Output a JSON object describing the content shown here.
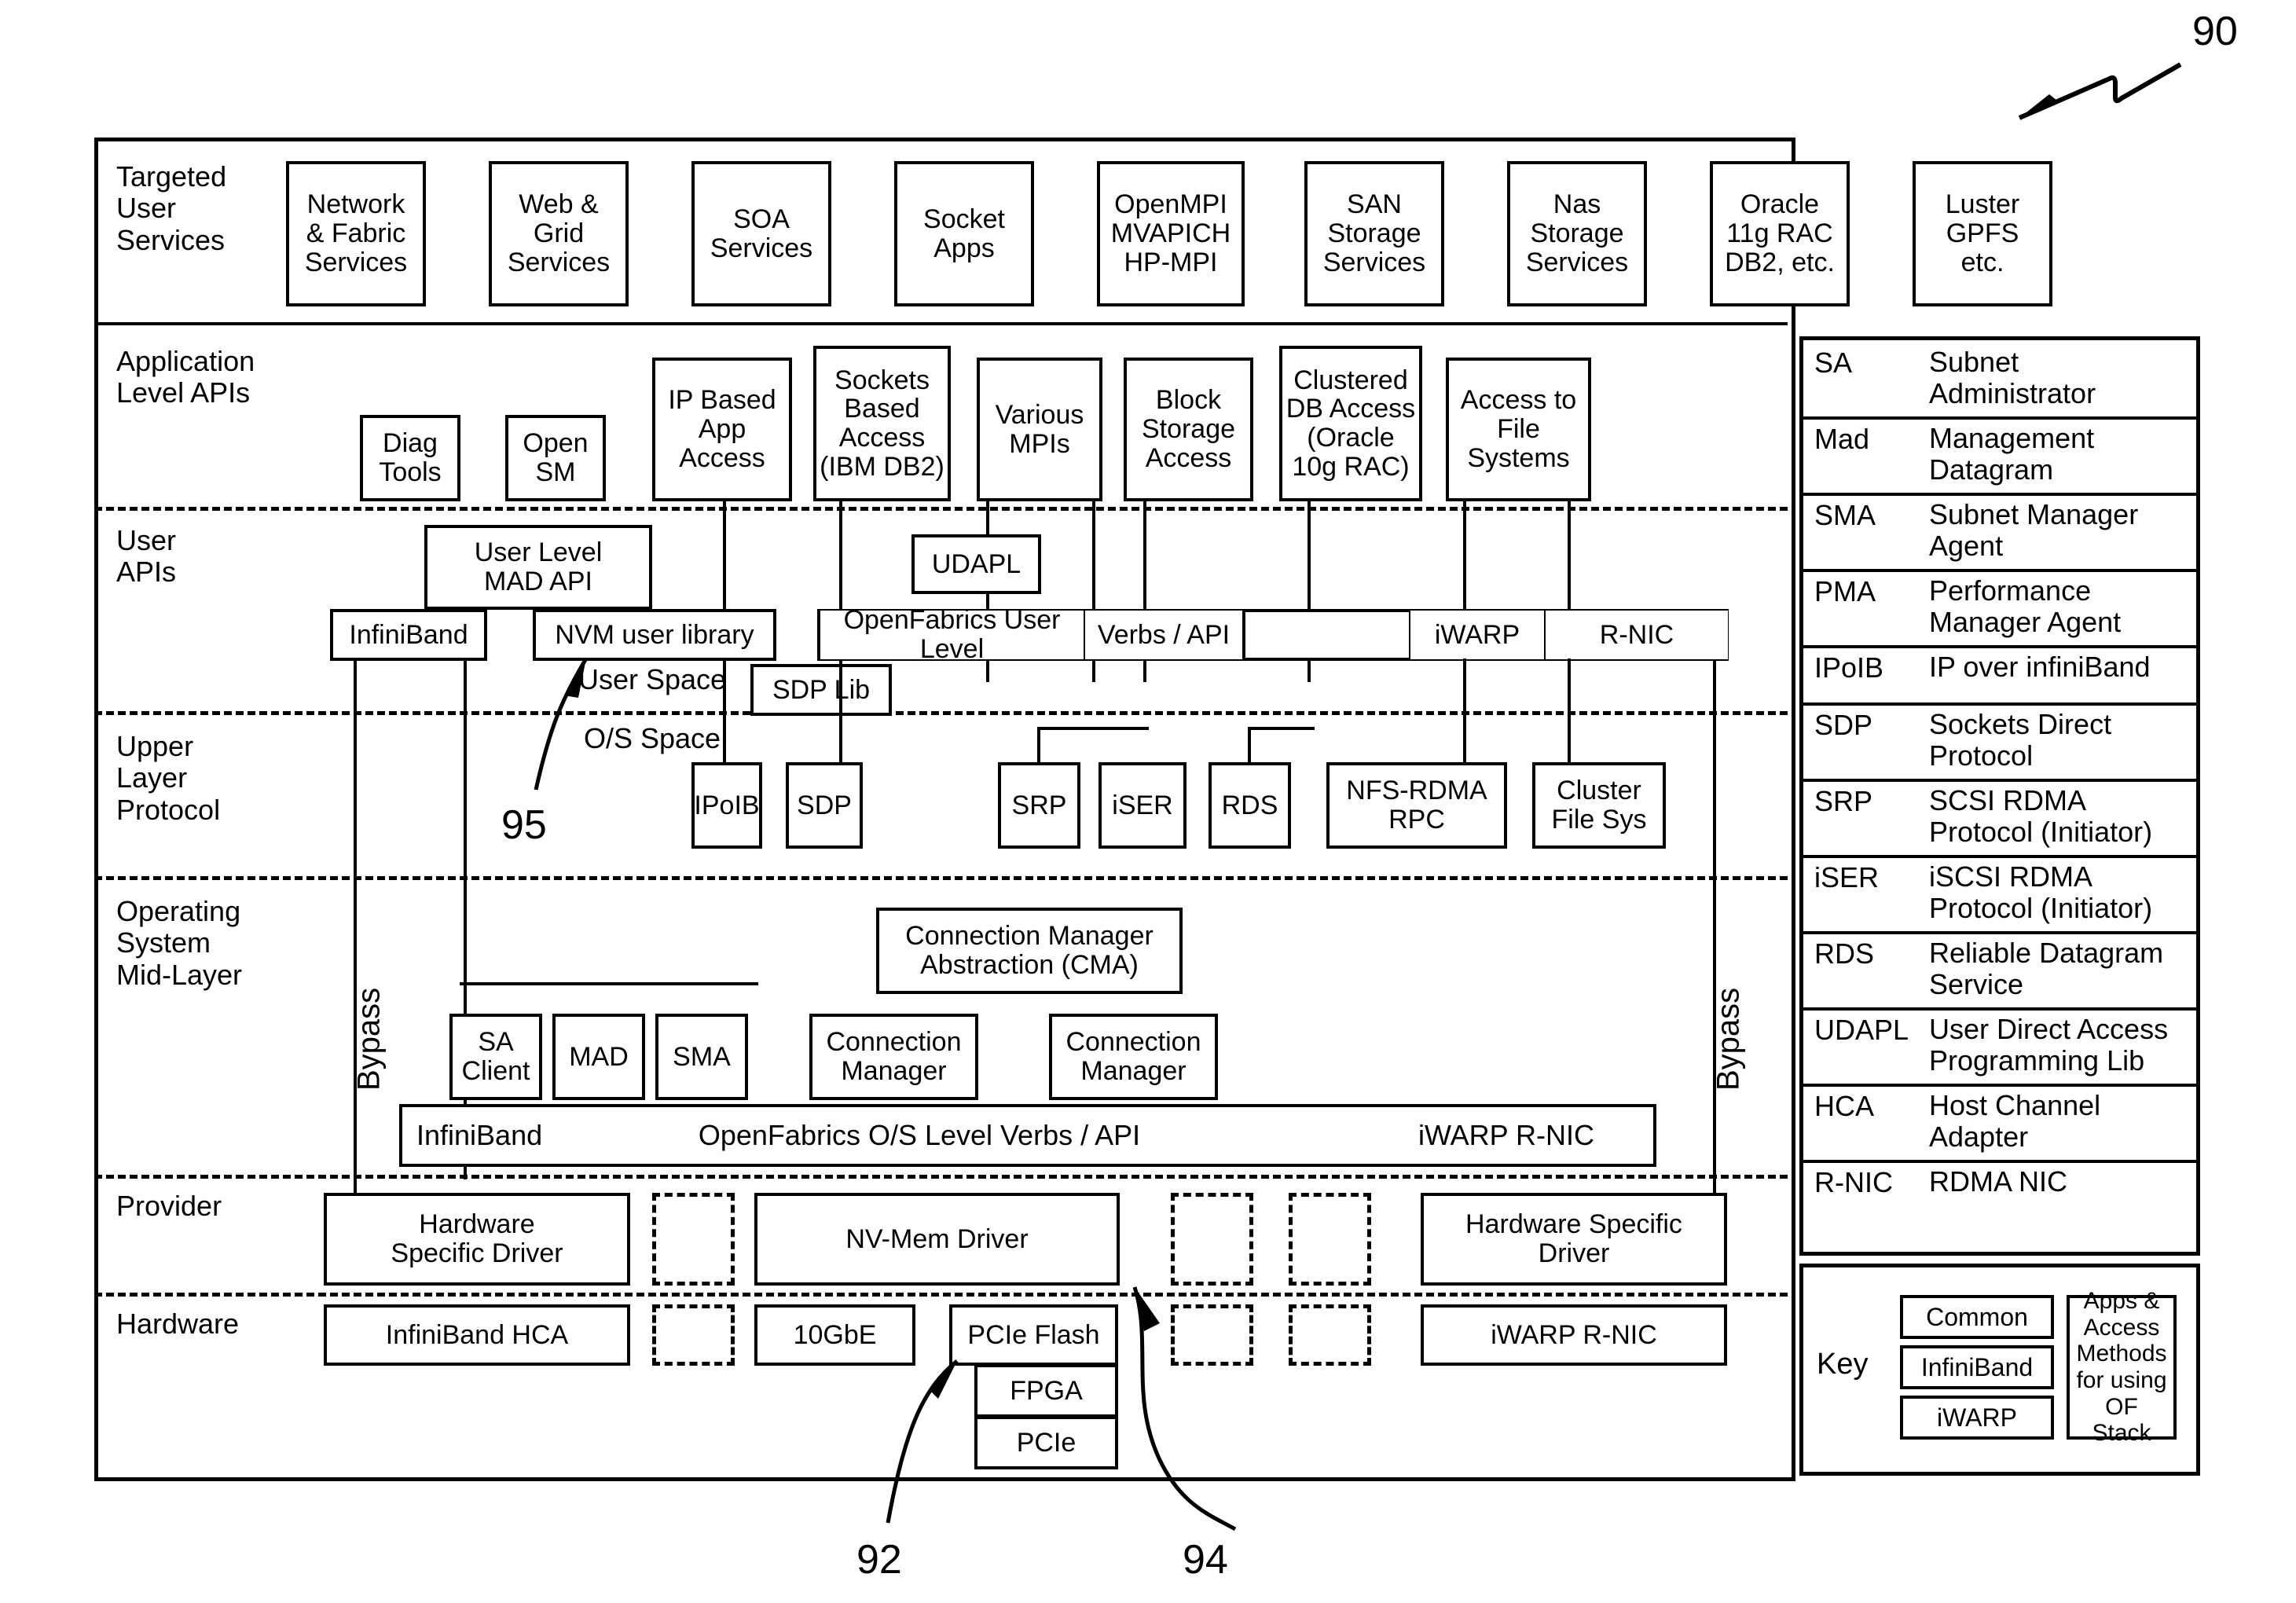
{
  "figure": {
    "ref_main": "90",
    "ref_pcie_flash": "92",
    "ref_nvmem_driver": "94",
    "ref_nvm_library": "95"
  },
  "rows": {
    "targeted_user_services": "Targeted\nUser\nServices",
    "application_level_apis": "Application\nLevel APIs",
    "user_apis": "User\nAPIs",
    "upper_layer_protocol": "Upper\nLayer\nProtocol",
    "os_mid_layer": "Operating\nSystem\nMid-Layer",
    "provider": "Provider",
    "hardware": "Hardware"
  },
  "targeted_services": [
    "Network\n& Fabric\nServices",
    "Web &\nGrid\nServices",
    "SOA\nServices",
    "Socket\nApps",
    "OpenMPI\nMVAPICH\nHP-MPI",
    "SAN\nStorage\nServices",
    "Nas\nStorage\nServices",
    "Oracle\n11g RAC\nDB2, etc.",
    "Luster\nGPFS\netc."
  ],
  "app_level_boxes": [
    "Diag\nTools",
    "Open\nSM",
    "IP Based\nApp\nAccess",
    "Sockets\nBased\nAccess\n(IBM DB2)",
    "Various\nMPIs",
    "Block\nStorage\nAccess",
    "Clustered\nDB Access\n(Oracle\n10g RAC)",
    "Access to\nFile\nSystems"
  ],
  "user_api": {
    "user_level_mad_api": "User Level\nMAD API",
    "udapl": "UDAPL",
    "infiniband": "InfiniBand",
    "nvm_user_library": "NVM user library",
    "openfabrics_user_level": "OpenFabrics User Level",
    "verbs_api": "Verbs / API",
    "iwarp": "iWARP",
    "rnic": "R-NIC",
    "sdp_lib": "SDP Lib",
    "user_space": "User Space",
    "os_space": "O/S Space"
  },
  "ulp_boxes": [
    "IPoIB",
    "SDP",
    "SRP",
    "iSER",
    "RDS",
    "NFS-RDMA\nRPC",
    "Cluster\nFile Sys"
  ],
  "mid_layer": {
    "bypass_left": "Bypass",
    "bypass_right": "Bypass",
    "cma": "Connection Manager\nAbstraction (CMA)",
    "sa_client": "SA\nClient",
    "mad": "MAD",
    "sma": "SMA",
    "connection_manager_1": "Connection\nManager",
    "connection_manager_2": "Connection\nManager",
    "bar_infiniband": "InfiniBand",
    "bar_openfabrics": "OpenFabrics O/S Level Verbs / API",
    "bar_iwarp_rnic": "iWARP R-NIC"
  },
  "provider": {
    "hw_specific_driver_left": "Hardware\nSpecific Driver",
    "nv_mem_driver": "NV-Mem Driver",
    "hw_specific_driver_right": "Hardware Specific\nDriver"
  },
  "hardware": {
    "infiniband_hca": "InfiniBand HCA",
    "tengbe": "10GbE",
    "pcie_flash": "PCIe Flash",
    "fpga": "FPGA",
    "pcie": "PCIe",
    "iwarp_rnic": "iWARP R-NIC"
  },
  "legend": [
    {
      "abbr": "SA",
      "desc": "Subnet\nAdministrator"
    },
    {
      "abbr": "Mad",
      "desc": "Management\nDatagram"
    },
    {
      "abbr": "SMA",
      "desc": "Subnet Manager\nAgent"
    },
    {
      "abbr": "PMA",
      "desc": "Performance\nManager Agent"
    },
    {
      "abbr": "IPoIB",
      "desc": "IP over infiniBand"
    },
    {
      "abbr": "SDP",
      "desc": "Sockets Direct\nProtocol"
    },
    {
      "abbr": "SRP",
      "desc": "SCSI RDMA\nProtocol (Initiator)"
    },
    {
      "abbr": "iSER",
      "desc": "iSCSI RDMA\nProtocol (Initiator)"
    },
    {
      "abbr": "RDS",
      "desc": "Reliable Datagram\nService"
    },
    {
      "abbr": "UDAPL",
      "desc": "User Direct Access\nProgramming Lib"
    },
    {
      "abbr": "HCA",
      "desc": "Host Channel\nAdapter"
    },
    {
      "abbr": "R-NIC",
      "desc": "RDMA NIC"
    }
  ],
  "key": {
    "title": "Key",
    "common": "Common",
    "infiniband": "InfiniBand",
    "iwarp": "iWARP",
    "note": "Apps &\nAccess\nMethods\nfor using\nOF Stack"
  }
}
